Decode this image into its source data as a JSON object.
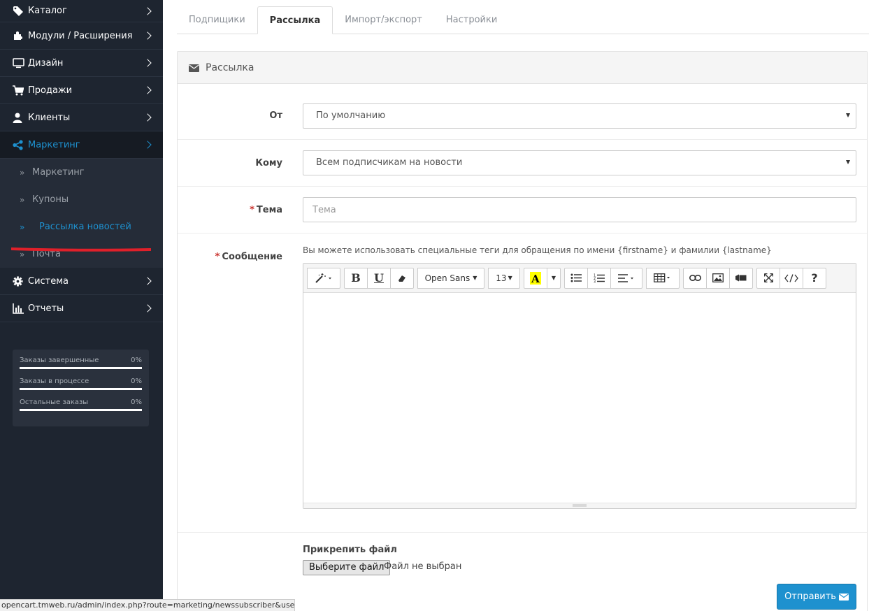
{
  "sidebar": {
    "items": [
      {
        "label": "Каталог",
        "icon": "tag-icon"
      },
      {
        "label": "Модули / Расширения",
        "icon": "puzzle-icon"
      },
      {
        "label": "Дизайн",
        "icon": "monitor-icon"
      },
      {
        "label": "Продажи",
        "icon": "cart-icon"
      },
      {
        "label": "Клиенты",
        "icon": "user-icon"
      },
      {
        "label": "Маркетинг",
        "icon": "share-icon"
      },
      {
        "label": "Система",
        "icon": "gear-icon"
      },
      {
        "label": "Отчеты",
        "icon": "bar-chart-icon"
      }
    ],
    "submenu": [
      {
        "label": "Маркетинг"
      },
      {
        "label": "Купоны"
      },
      {
        "label": "Рассылка новостей"
      },
      {
        "label": "Почта"
      }
    ],
    "stats": [
      {
        "label": "Заказы завершенные",
        "value": "0%"
      },
      {
        "label": "Заказы в процессе",
        "value": "0%"
      },
      {
        "label": "Остальные заказы",
        "value": "0%"
      }
    ]
  },
  "tabs": [
    {
      "label": "Подпищики"
    },
    {
      "label": "Рассылка"
    },
    {
      "label": "Импорт/экспорт"
    },
    {
      "label": "Настройки"
    }
  ],
  "panel": {
    "title": "Рассылка",
    "from_label": "От",
    "from_value": "По умолчанию",
    "to_label": "Кому",
    "to_value": "Всем подписчикам на новости",
    "subject_label": "Тема",
    "subject_placeholder": "Тема",
    "message_label": "Сообщение",
    "message_hint": "Вы можете использовать специальные теги для обращения по имени {firstname} и фамилии {lastname}",
    "editor": {
      "font_name": "Open Sans",
      "font_size": "13"
    },
    "attach_label": "Прикрепить файл",
    "file_button": "Выберите файл",
    "file_status": "Файл не выбран",
    "send_button": "Отправить"
  },
  "status_url": "opencart.tmweb.ru/admin/index.php?route=marketing/newssubscriber&user...",
  "colors": {
    "accent": "#1e91cf",
    "sidebar": "#1e2530",
    "required": "#c9302c",
    "annotation": "#e0202a"
  }
}
